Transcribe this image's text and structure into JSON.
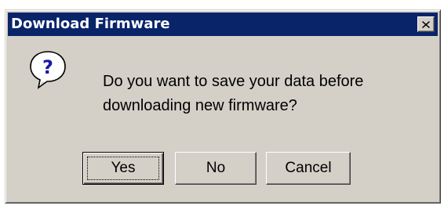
{
  "window": {
    "title": "Download Firmware",
    "close_icon": "close-icon"
  },
  "message": {
    "icon": "question-icon",
    "line1": "Do you want to save your data before",
    "line2": "downloading new firmware?"
  },
  "buttons": {
    "yes": "Yes",
    "no": "No",
    "cancel": "Cancel",
    "default": "yes"
  },
  "colors": {
    "titlebar": "#0a246a",
    "face": "#d4d0c8",
    "icon_blue": "#1a1aa6"
  }
}
